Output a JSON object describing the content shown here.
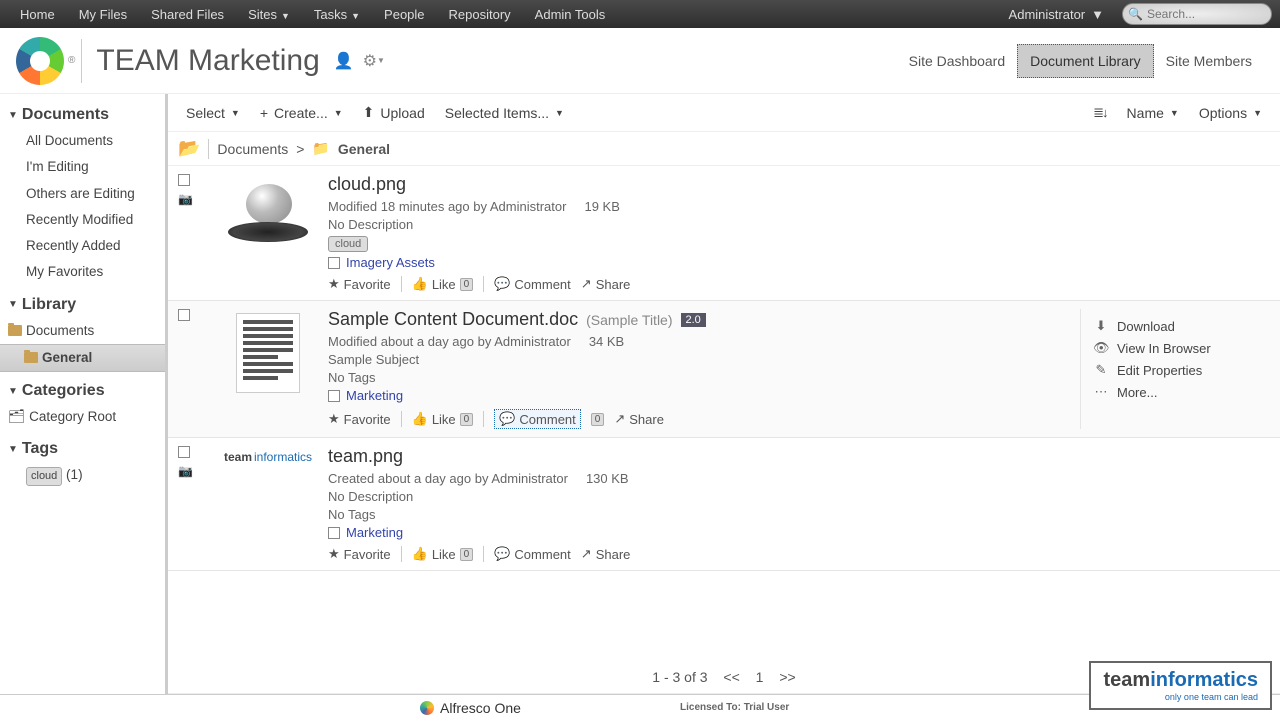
{
  "topnav": {
    "items": [
      "Home",
      "My Files",
      "Shared Files",
      "Sites",
      "Tasks",
      "People",
      "Repository",
      "Admin Tools"
    ],
    "dropdown_flags": [
      false,
      false,
      false,
      true,
      true,
      false,
      false,
      false
    ],
    "user": "Administrator",
    "search_placeholder": "Search..."
  },
  "site": {
    "title": "TEAM Marketing",
    "nav": [
      "Site Dashboard",
      "Document Library",
      "Site Members"
    ],
    "active_nav": 1
  },
  "sidebar": {
    "documents": {
      "header": "Documents",
      "items": [
        "All Documents",
        "I'm Editing",
        "Others are Editing",
        "Recently Modified",
        "Recently Added",
        "My Favorites"
      ]
    },
    "library": {
      "header": "Library",
      "root": "Documents",
      "children": [
        "General"
      ],
      "selected": "General"
    },
    "categories": {
      "header": "Categories",
      "root": "Category Root"
    },
    "tags": {
      "header": "Tags",
      "items": [
        {
          "name": "cloud",
          "count": 1
        }
      ]
    }
  },
  "toolbar": {
    "select": "Select",
    "create": "Create...",
    "upload": "Upload",
    "selected": "Selected Items...",
    "sort": "Name",
    "options": "Options"
  },
  "breadcrumb": {
    "root": "Documents",
    "current": "General"
  },
  "docs": [
    {
      "title": "cloud.png",
      "subtitle": "",
      "version": "",
      "modline": "Modified 18 minutes ago by Administrator",
      "size": "19 KB",
      "desc": "No Description",
      "tags": [
        "cloud"
      ],
      "no_tags_label": "",
      "category": "Imagery Assets",
      "has_cam": true,
      "thumb": "cloud"
    },
    {
      "title": "Sample Content Document.doc",
      "subtitle": "(Sample Title)",
      "version": "2.0",
      "modline": "Modified about a day ago by Administrator",
      "size": "34 KB",
      "desc": "Sample Subject",
      "tags": [],
      "no_tags_label": "No Tags",
      "category": "Marketing",
      "has_cam": false,
      "thumb": "doc",
      "hovered": true,
      "comment_hl": true,
      "row_actions": true
    },
    {
      "title": "team.png",
      "subtitle": "",
      "version": "",
      "modline": "Created about a day ago by Administrator",
      "size": "130 KB",
      "desc": "No Description",
      "tags": [],
      "no_tags_label": "No Tags",
      "category": "Marketing",
      "has_cam": true,
      "thumb": "team"
    }
  ],
  "doc_actions": {
    "favorite": "Favorite",
    "like": "Like",
    "comment": "Comment",
    "share": "Share",
    "like_count": "0"
  },
  "row_actions": {
    "download": "Download",
    "view": "View In Browser",
    "edit": "Edit Properties",
    "more": "More..."
  },
  "pager": {
    "range": "1 - 3 of 3",
    "prev": "<<",
    "page": "1",
    "next": ">>"
  },
  "footer": {
    "product": "Alfresco One",
    "license": "Licensed To: Trial User"
  },
  "brand": {
    "name_a": "team",
    "name_b": "informatics",
    "tagline": "only one team can lead"
  }
}
